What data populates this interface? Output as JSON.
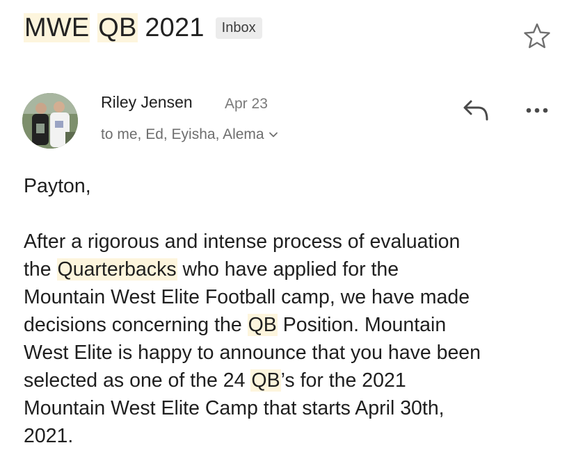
{
  "email": {
    "subject_parts": [
      "MWE",
      "QB",
      "2021"
    ],
    "label": "Inbox",
    "sender": "Riley Jensen",
    "date": "Apr 23",
    "recipients": "to me, Ed, Eyisha, Alema",
    "greeting": "Payton,",
    "body_lines": [
      [
        "After a rigorous and intense process of evaluation"
      ],
      [
        "the ",
        "Quarterbacks",
        " who have applied for the"
      ],
      [
        "Mountain West Elite Football camp, we have made"
      ],
      [
        "decisions concerning the ",
        "QB",
        " Position. Mountain"
      ],
      [
        "West Elite is happy to announce that you have been"
      ],
      [
        "selected as one of the 24 ",
        "QB",
        "’s for the 2021"
      ],
      [
        "Mountain West Elite Camp that starts April 30th,"
      ],
      [
        "2021."
      ]
    ]
  },
  "icons": {
    "star": "star-outline-icon",
    "reply": "reply-arrow-icon",
    "more": "more-dots-icon",
    "expand": "chevron-down-icon"
  },
  "colors": {
    "highlight": "#fdf5dd",
    "badge_bg": "#ececec",
    "secondary_text": "#6e6e6e"
  }
}
